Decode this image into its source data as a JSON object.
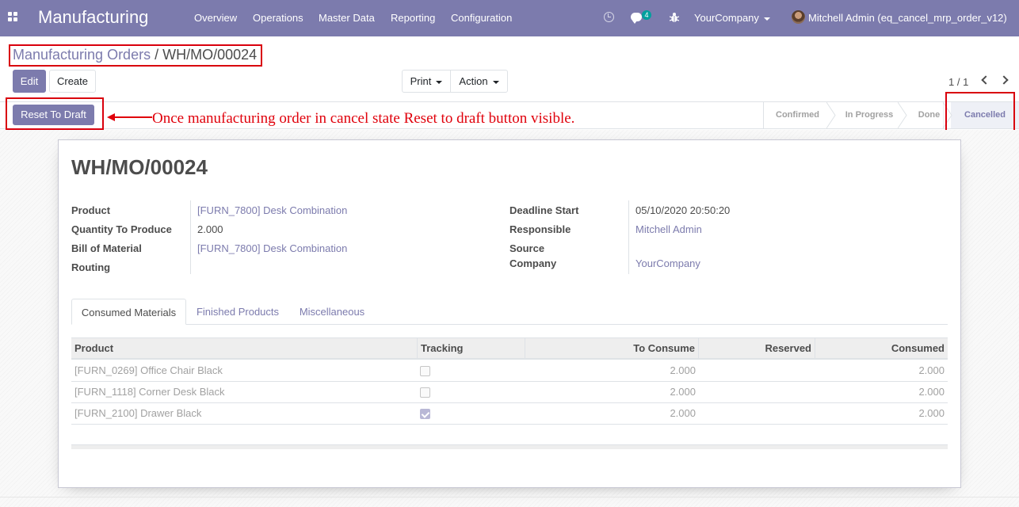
{
  "navbar": {
    "app_name": "Manufacturing",
    "menus": [
      "Overview",
      "Operations",
      "Master Data",
      "Reporting",
      "Configuration"
    ],
    "chat_count": "4",
    "company": "YourCompany",
    "user": "Mitchell Admin (eq_cancel_mrp_order_v12)",
    "icons": [
      "apps-icon",
      "clock-icon",
      "chat-icon",
      "bug-icon"
    ]
  },
  "breadcrumb": {
    "parent": "Manufacturing Orders",
    "separator": "/",
    "current": "WH/MO/00024"
  },
  "control_panel": {
    "edit_label": "Edit",
    "create_label": "Create",
    "print_label": "Print",
    "action_label": "Action",
    "pager": "1 / 1"
  },
  "statusbar": {
    "reset_label": "Reset To Draft",
    "annotation": "Once manufacturing order in cancel state Reset to draft button visible.",
    "stages": [
      "Confirmed",
      "In Progress",
      "Done",
      "Cancelled"
    ],
    "current_stage": "Cancelled"
  },
  "form": {
    "title": "WH/MO/00024",
    "left": {
      "product_label": "Product",
      "product_value": "[FURN_7800] Desk Combination",
      "qty_label": "Quantity To Produce",
      "qty_value": "2.000",
      "bom_label": "Bill of Material",
      "bom_value": "[FURN_7800] Desk Combination",
      "routing_label": "Routing"
    },
    "right": {
      "deadline_label": "Deadline Start",
      "deadline_value": "05/10/2020 20:50:20",
      "responsible_label": "Responsible",
      "responsible_value": "Mitchell Admin",
      "source_label": "Source",
      "company_label": "Company",
      "company_value": "YourCompany"
    }
  },
  "tabs": [
    "Consumed Materials",
    "Finished Products",
    "Miscellaneous"
  ],
  "table": {
    "headers": [
      "Product",
      "Tracking",
      "To Consume",
      "Reserved",
      "Consumed"
    ],
    "rows": [
      {
        "product": "[FURN_0269] Office Chair Black",
        "tracked": false,
        "to_consume": "2.000",
        "reserved": "",
        "consumed": "2.000"
      },
      {
        "product": "[FURN_1118] Corner Desk Black",
        "tracked": false,
        "to_consume": "2.000",
        "reserved": "",
        "consumed": "2.000"
      },
      {
        "product": "[FURN_2100] Drawer Black",
        "tracked": true,
        "to_consume": "2.000",
        "reserved": "",
        "consumed": "2.000"
      }
    ]
  },
  "colors": {
    "brand": "#7c7bad",
    "annotation_red": "#e0000b",
    "link": "#7c7bad"
  }
}
